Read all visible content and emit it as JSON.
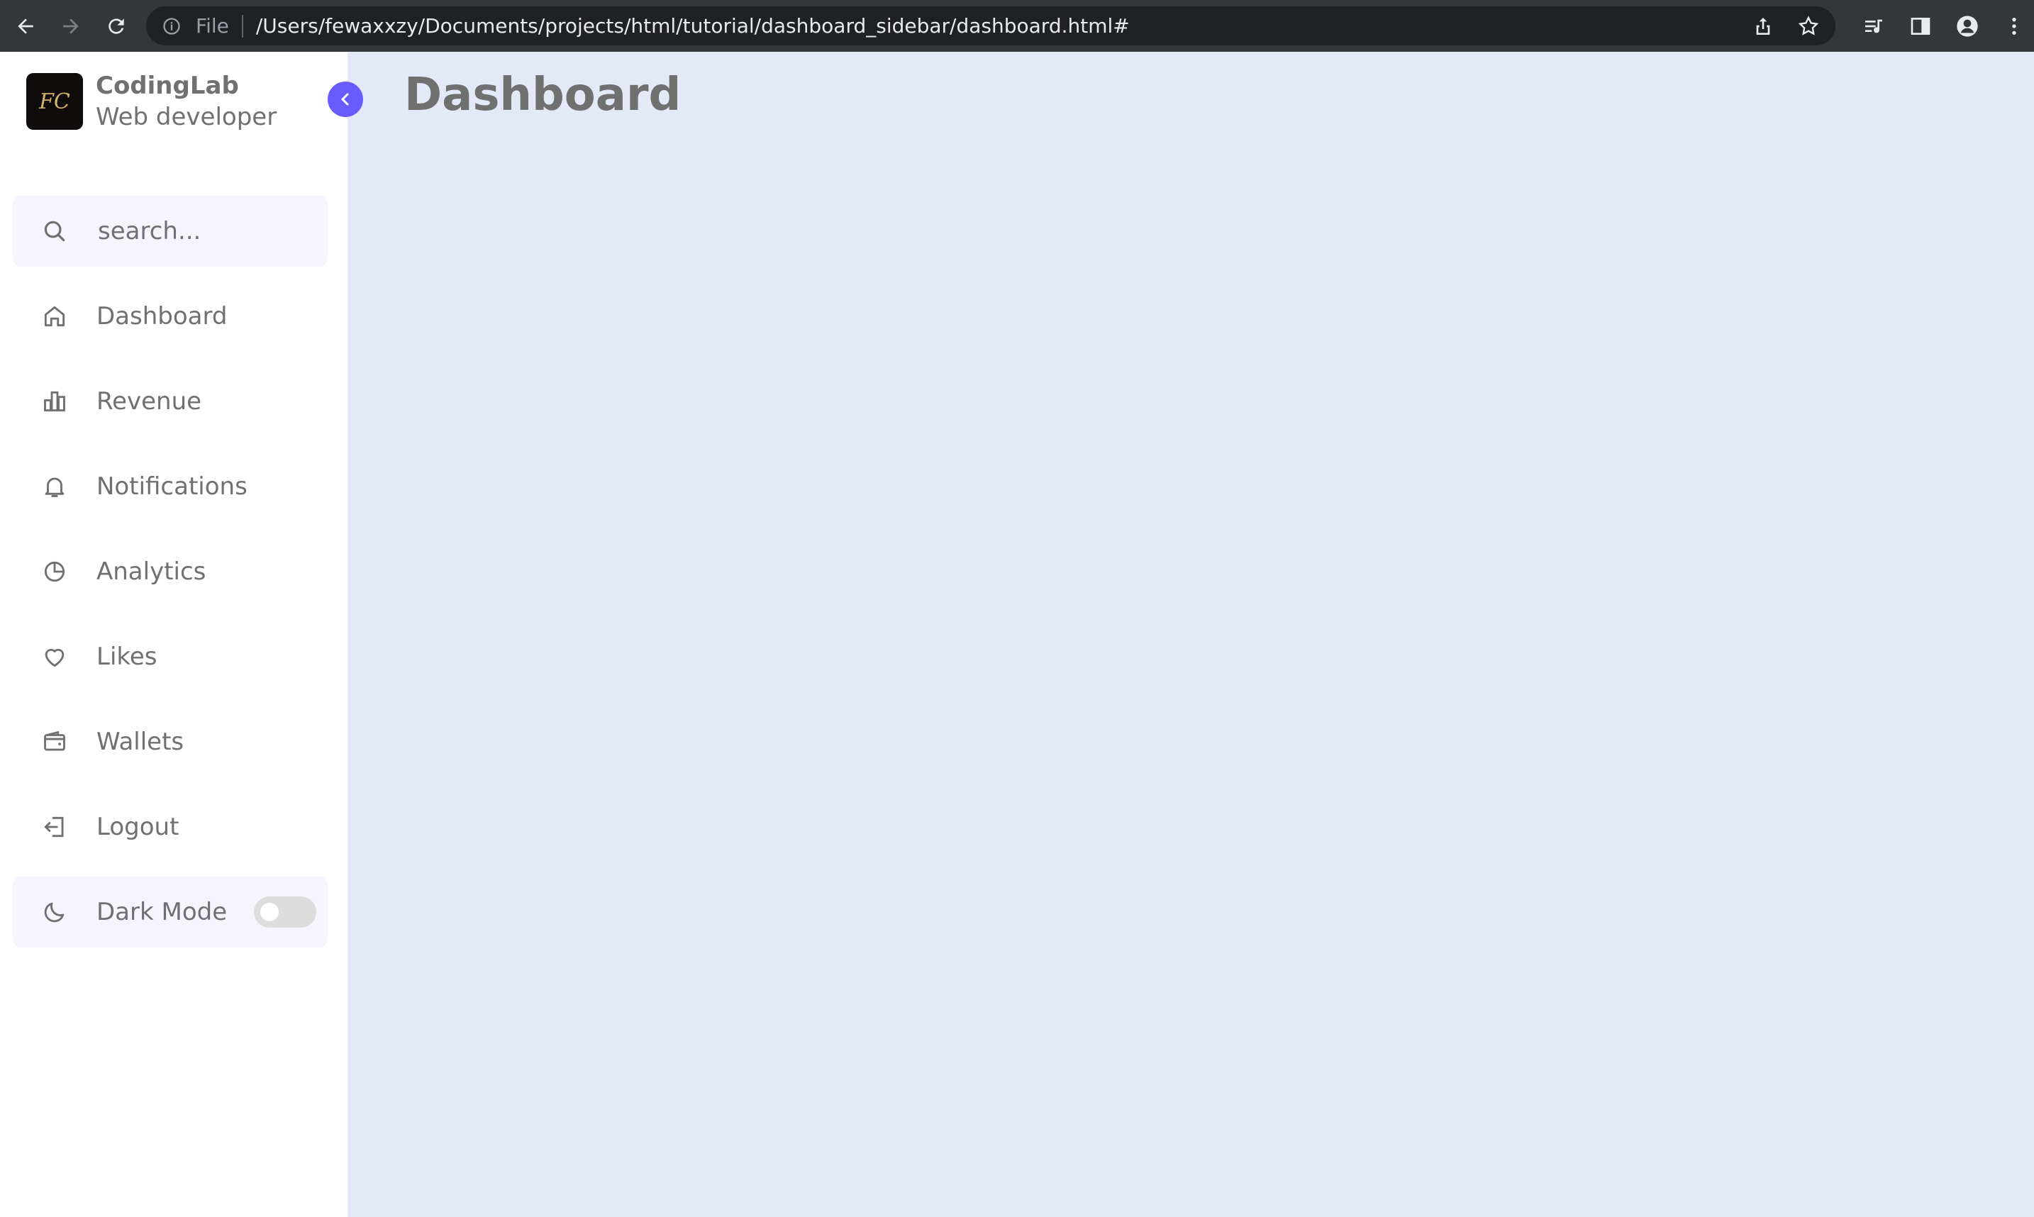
{
  "browser": {
    "file_label": "File",
    "url": "/Users/fewaxxzy/Documents/projects/html/tutorial/dashboard_sidebar/dashboard.html#"
  },
  "sidebar": {
    "brand_name": "CodingLab",
    "brand_role": "Web developer",
    "logo_text": "FC",
    "search_placeholder": "search...",
    "items": [
      {
        "label": "Dashboard",
        "icon": "home-icon"
      },
      {
        "label": "Revenue",
        "icon": "bar-chart-icon"
      },
      {
        "label": "Notifications",
        "icon": "bell-icon"
      },
      {
        "label": "Analytics",
        "icon": "pie-chart-icon"
      },
      {
        "label": "Likes",
        "icon": "heart-icon"
      },
      {
        "label": "Wallets",
        "icon": "wallet-icon"
      },
      {
        "label": "Logout",
        "icon": "logout-icon"
      }
    ],
    "dark_mode_label": "Dark Mode",
    "dark_mode_on": false
  },
  "main": {
    "title": "Dashboard"
  },
  "colors": {
    "accent": "#695cfe",
    "sidebar_bg": "#ffffff",
    "body_bg": "#e4e9f7",
    "text": "#707070"
  }
}
